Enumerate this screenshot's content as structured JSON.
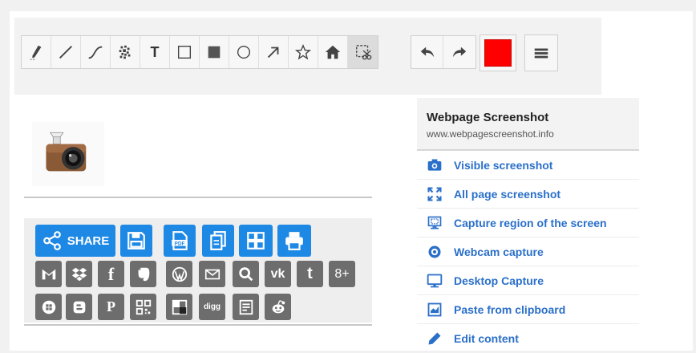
{
  "toolbar": {
    "tools": [
      {
        "icon": "pencil-icon"
      },
      {
        "icon": "line-icon"
      },
      {
        "icon": "curve-icon"
      },
      {
        "icon": "blur-icon"
      },
      {
        "icon": "text-tool-icon",
        "label": "T"
      },
      {
        "icon": "rectangle-outline-icon"
      },
      {
        "icon": "rectangle-filled-icon"
      },
      {
        "icon": "circle-icon"
      },
      {
        "icon": "arrow-icon"
      },
      {
        "icon": "star-icon"
      },
      {
        "icon": "home-icon"
      },
      {
        "icon": "crop-icon"
      }
    ],
    "history": [
      {
        "icon": "undo-icon"
      },
      {
        "icon": "redo-icon"
      }
    ],
    "color": "#ff0000",
    "menu_icon": "hamburger-menu-icon"
  },
  "share": {
    "label": "SHARE",
    "buttons": [
      "save-icon",
      "pdf-icon",
      "copy-icon",
      "grid-icon",
      "print-icon"
    ],
    "pdf_text": "PDF",
    "accent": "#1e88e5"
  },
  "social_row1": [
    "gmail-icon",
    "dropbox-icon",
    "facebook-icon",
    "evernote-icon",
    "wordpress-icon",
    "email-icon",
    "search-icon",
    "vk-icon",
    "tumblr-icon",
    "google-plus-icon"
  ],
  "social_row2": [
    "windows-icon",
    "blogger-icon",
    "pinterest-icon",
    "qr-code-icon",
    "delicious-icon",
    "digg-icon",
    "feed-icon",
    "reddit-icon"
  ],
  "social_text": {
    "vk": "vk",
    "tumblr": "t",
    "gplus": "8+",
    "digg": "digg",
    "fb": "f",
    "pinterest": "P",
    "blogger": "B"
  },
  "panel": {
    "title": "Webpage Screenshot",
    "subtitle": "www.webpagescreenshot.info",
    "items": [
      {
        "label": "Visible screenshot",
        "icon": "camera-icon"
      },
      {
        "label": "All page screenshot",
        "icon": "expand-icon"
      },
      {
        "label": "Capture region of the screen",
        "icon": "monitor-region-icon"
      },
      {
        "label": "Webcam capture",
        "icon": "webcam-icon"
      },
      {
        "label": "Desktop Capture",
        "icon": "desktop-icon"
      },
      {
        "label": "Paste from clipboard",
        "icon": "clipboard-icon"
      },
      {
        "label": "Edit content",
        "icon": "pencil-edit-icon"
      }
    ]
  }
}
